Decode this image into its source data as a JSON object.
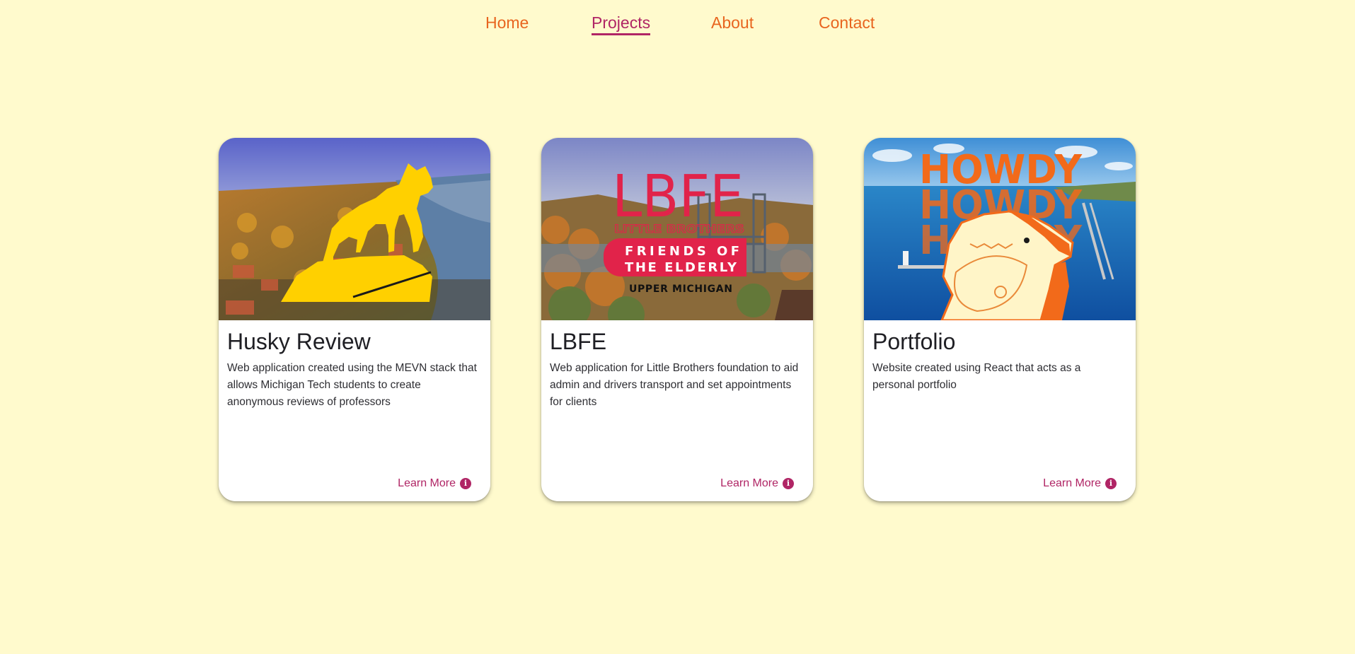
{
  "nav": {
    "items": [
      {
        "label": "Home"
      },
      {
        "label": "Projects",
        "active": true
      },
      {
        "label": "About"
      },
      {
        "label": "Contact"
      }
    ]
  },
  "colors": {
    "background": "#fffacd",
    "nav_link": "#e8651f",
    "accent": "#b02565"
  },
  "projects": [
    {
      "title": "Husky Review",
      "description": "Web application created using the MEVN stack that allows Michigan Tech students to create anonymous reviews of professors",
      "link_label": "Learn More",
      "link_icon": "info-icon",
      "image": {
        "subject": "husky-logo-over-campus"
      }
    },
    {
      "title": "LBFE",
      "description": "Web application for Little Brothers foundation to aid admin and drivers transport and set appointments for clients",
      "link_label": "Learn More",
      "link_icon": "info-icon",
      "image": {
        "subject": "lbfe-logo-over-town",
        "logo_lines": [
          "LBFE",
          "LITTLE BROTHERS",
          "FRIENDS OF",
          "THE ELDERLY",
          "UPPER MICHIGAN"
        ]
      }
    },
    {
      "title": "Portfolio",
      "description": "Website created using React that acts as a personal portfolio",
      "link_label": "Learn More",
      "link_icon": "info-icon",
      "image": {
        "subject": "howdy-cartoon-over-lake",
        "logo_lines": [
          "HOWDY",
          "HOWDY",
          "HOWDY"
        ]
      }
    }
  ]
}
